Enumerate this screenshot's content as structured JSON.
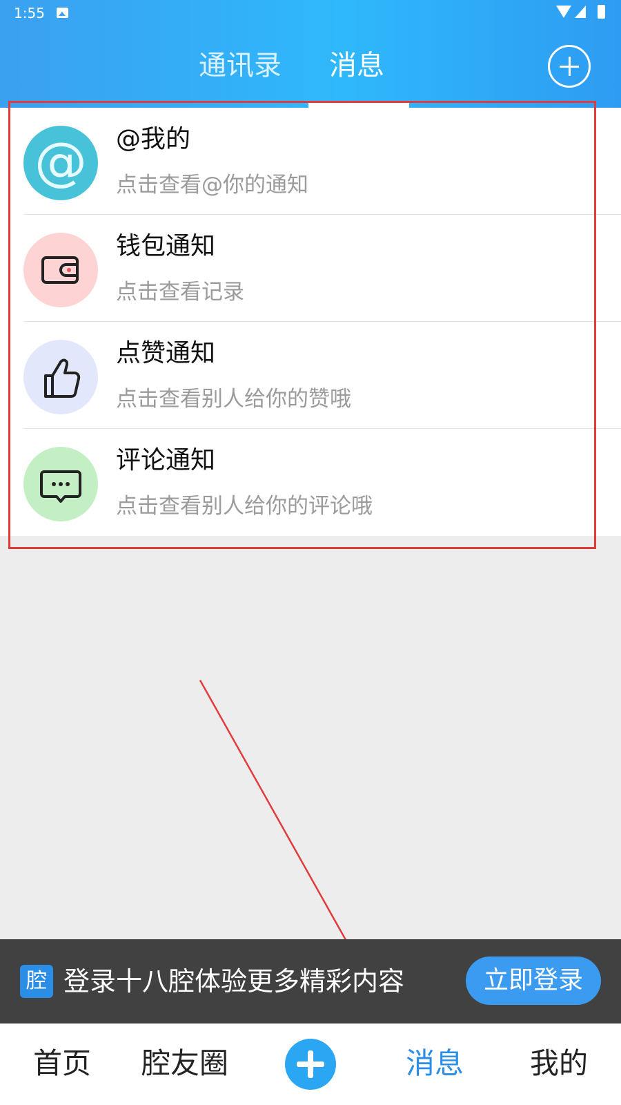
{
  "status_bar": {
    "time": "1:55"
  },
  "header": {
    "tabs": [
      {
        "label": "通讯录",
        "active": false
      },
      {
        "label": "消息",
        "active": true
      }
    ],
    "add_icon": "plus-circle-icon"
  },
  "notifications": [
    {
      "title": "@我的",
      "subtitle": "点击查看@你的通知",
      "icon": "at-icon",
      "color": "#47c2d8"
    },
    {
      "title": "钱包通知",
      "subtitle": "点击查看记录",
      "icon": "wallet-icon",
      "color": "#fdd3d3"
    },
    {
      "title": "点赞通知",
      "subtitle": "点击查看别人给你的赞哦",
      "icon": "thumbs-up-icon",
      "color": "#e3e7fb"
    },
    {
      "title": "评论通知",
      "subtitle": "点击查看别人给你的评论哦",
      "icon": "comment-icon",
      "color": "#c4efc4"
    }
  ],
  "login_banner": {
    "logo_text": "腔",
    "message": "登录十八腔体验更多精彩内容",
    "button": "立即登录"
  },
  "bottom_nav": {
    "home": "首页",
    "circle": "腔友圈",
    "messages": "消息",
    "me": "我的",
    "active": "消息"
  },
  "colors": {
    "accent": "#2a8de6",
    "annotation": "#e23b3b"
  }
}
